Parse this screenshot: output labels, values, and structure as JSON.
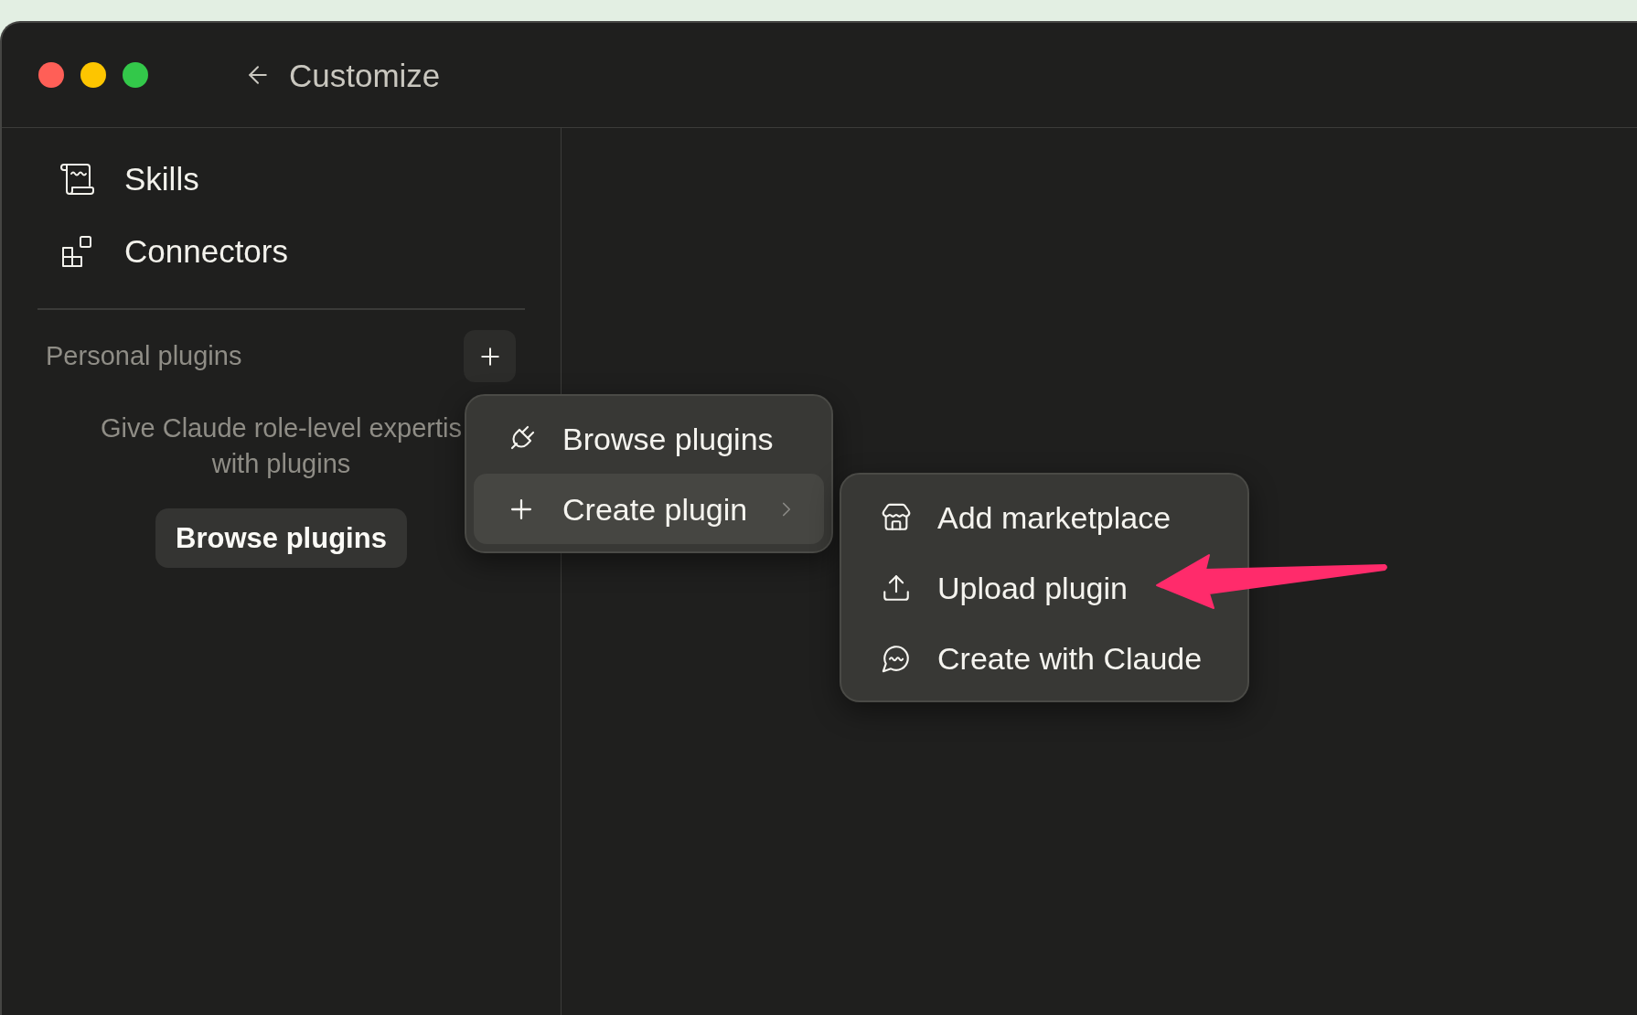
{
  "window": {
    "title": "Customize"
  },
  "sidebar": {
    "nav_items": [
      {
        "label": "Skills"
      },
      {
        "label": "Connectors"
      }
    ],
    "section": {
      "title": "Personal plugins"
    },
    "empty_state": {
      "lines": [
        "Give Claude role-level expertis",
        "with plugins"
      ],
      "button": "Browse plugins"
    }
  },
  "menu": {
    "items": [
      {
        "label": "Browse plugins",
        "highlighted": false,
        "has_submenu": false
      },
      {
        "label": "Create plugin",
        "highlighted": true,
        "has_submenu": true
      }
    ]
  },
  "submenu": {
    "items": [
      {
        "label": "Add marketplace"
      },
      {
        "label": "Upload plugin"
      },
      {
        "label": "Create with Claude"
      }
    ]
  }
}
